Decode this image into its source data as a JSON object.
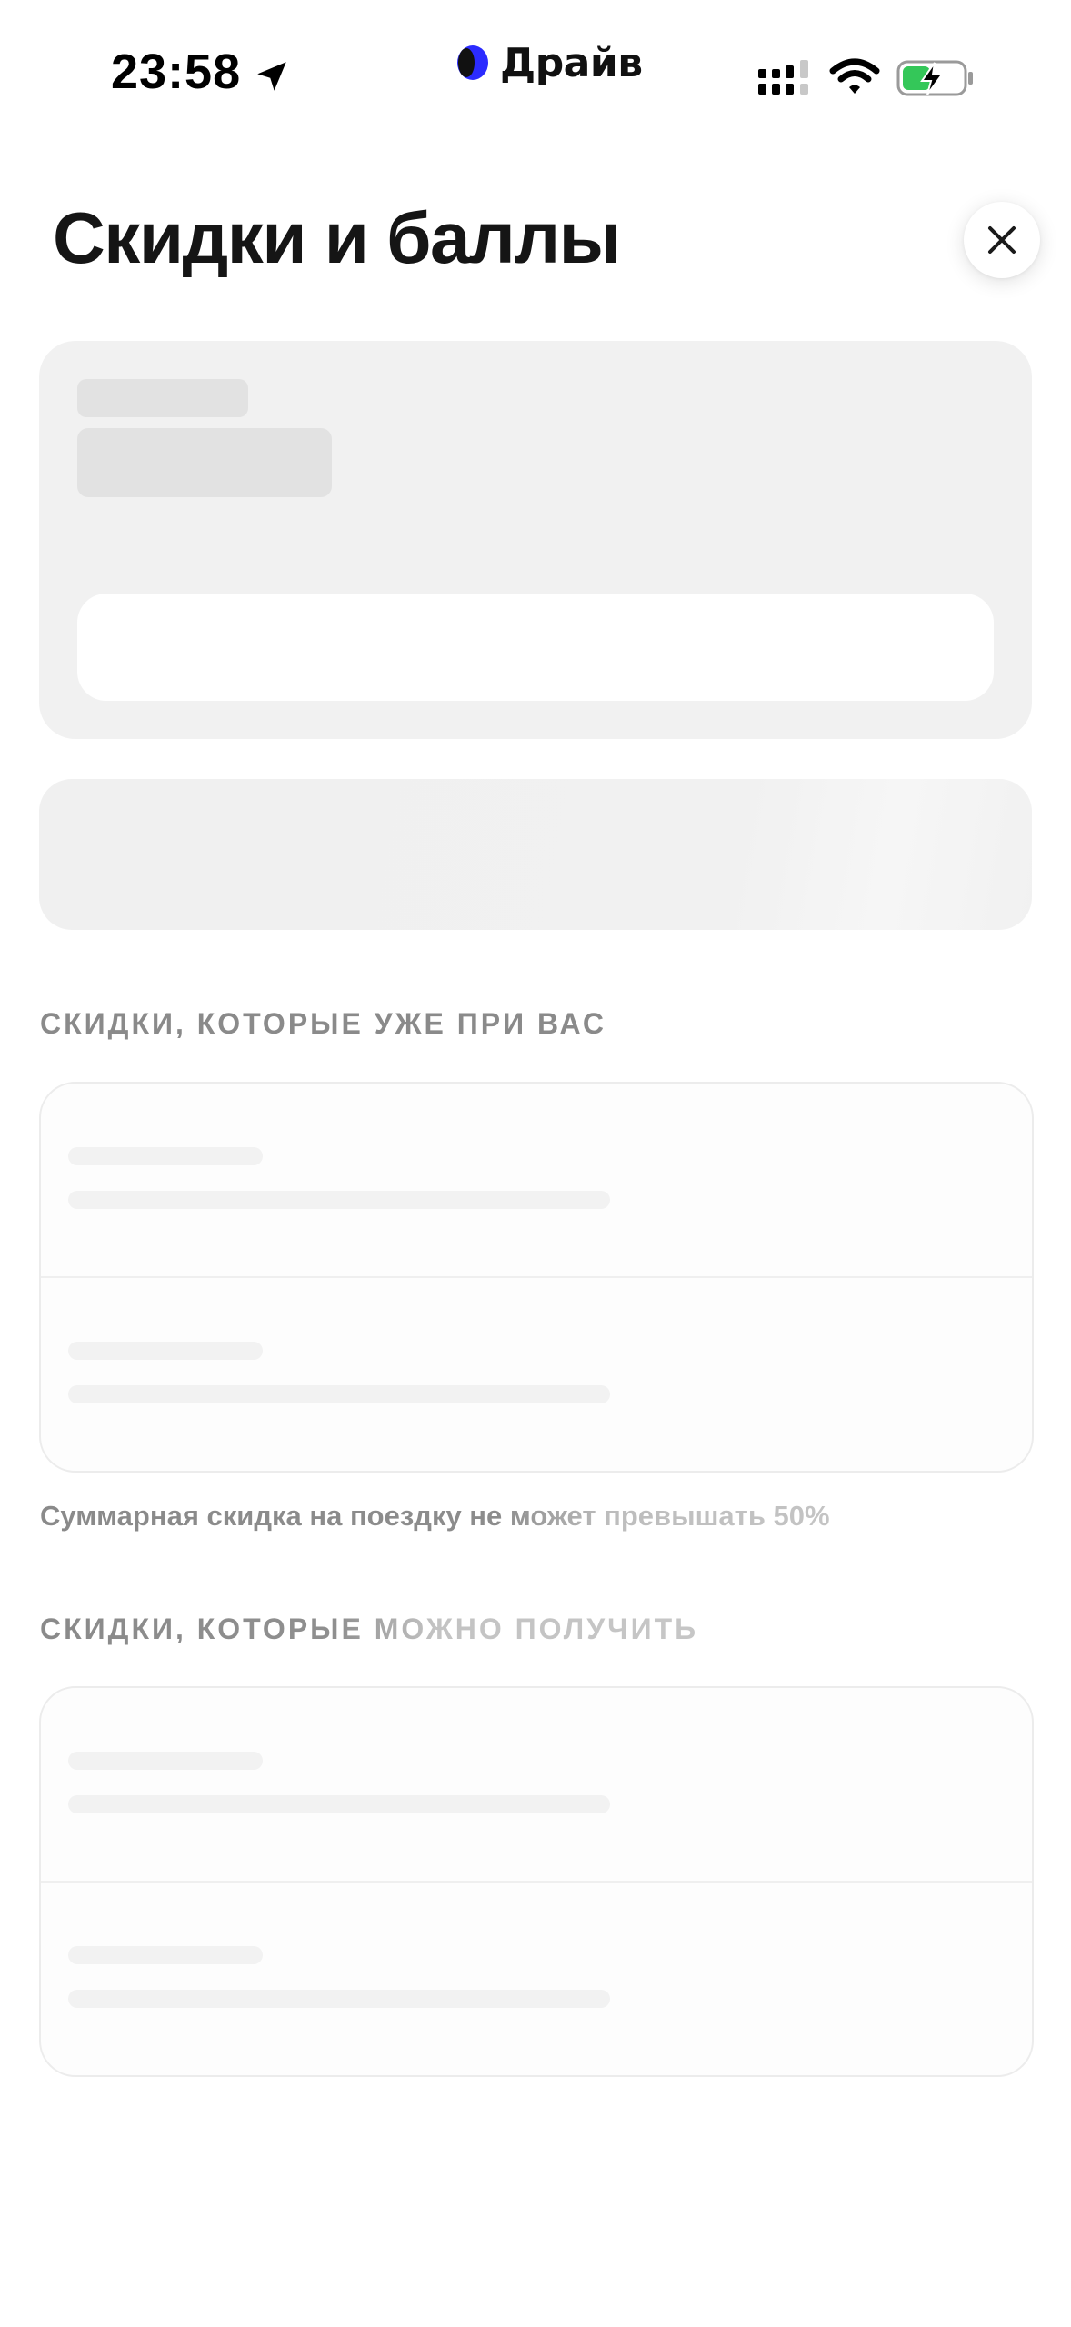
{
  "status_bar": {
    "time": "23:58",
    "app_name": "Драйв",
    "icons": [
      "location-arrow-icon",
      "cellular-signal-icon",
      "wifi-icon",
      "battery-charging-icon"
    ]
  },
  "header": {
    "title": "Скидки и баллы",
    "close_icon": "close-icon"
  },
  "sections": {
    "active": {
      "title": "СКИДКИ, КОТОРЫЕ УЖЕ ПРИ ВАС",
      "note": "Суммарная скидка на поездку не может превышать 50%"
    },
    "available": {
      "title": "СКИДКИ, КОТОРЫЕ МОЖНО ПОЛУЧИТЬ"
    }
  },
  "colors": {
    "skeleton": "#f1f1f1",
    "skeleton_dark": "#e2e2e2",
    "section_text": "#8a8a8a",
    "brand_blue": "#2b2bff",
    "battery_green": "#34c759"
  }
}
